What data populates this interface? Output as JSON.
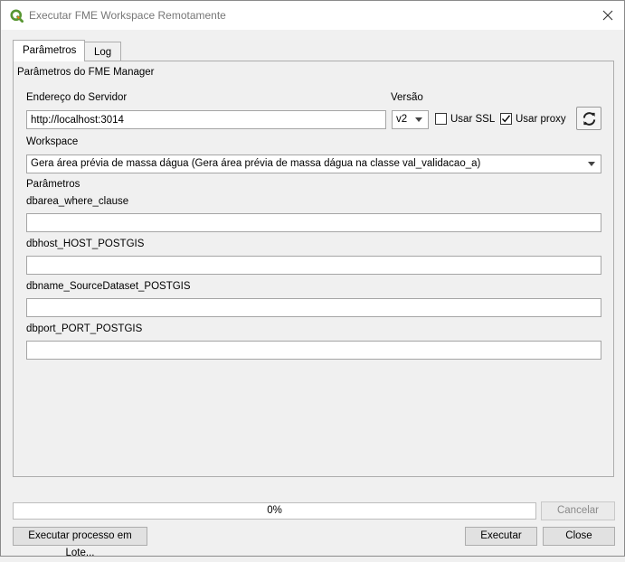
{
  "window": {
    "title": "Executar FME Workspace Remotamente"
  },
  "tabs": [
    {
      "label": "Parâmetros"
    },
    {
      "label": "Log"
    }
  ],
  "group": {
    "title": "Parâmetros do FME Manager"
  },
  "server": {
    "label": "Endereço do Servidor",
    "value": "http://localhost:3014"
  },
  "version": {
    "label": "Versão",
    "selected": "v2"
  },
  "ssl": {
    "label": "Usar SSL",
    "checked": false
  },
  "proxy": {
    "label": "Usar proxy",
    "checked": true
  },
  "workspace": {
    "label": "Workspace",
    "selected": "Gera área prévia de massa dágua (Gera área prévia de massa dágua na classe val_validacao_a)"
  },
  "parameters": {
    "title": "Parâmetros",
    "fields": [
      {
        "label": "dbarea_where_clause",
        "value": ""
      },
      {
        "label": "dbhost_HOST_POSTGIS",
        "value": ""
      },
      {
        "label": "dbname_SourceDataset_POSTGIS",
        "value": ""
      },
      {
        "label": "dbport_PORT_POSTGIS",
        "value": ""
      }
    ]
  },
  "progress": {
    "text": "0%",
    "value": 0
  },
  "buttons": {
    "cancel": "Cancelar",
    "batch": "Executar processo em Lote...",
    "run": "Executar",
    "close": "Close"
  },
  "icons": {
    "app": "qgis-logo-icon",
    "refresh": "refresh-icon",
    "close": "close-icon"
  },
  "colors": {
    "qgis_green": "#589632",
    "qgis_yellow": "#ee7913"
  }
}
